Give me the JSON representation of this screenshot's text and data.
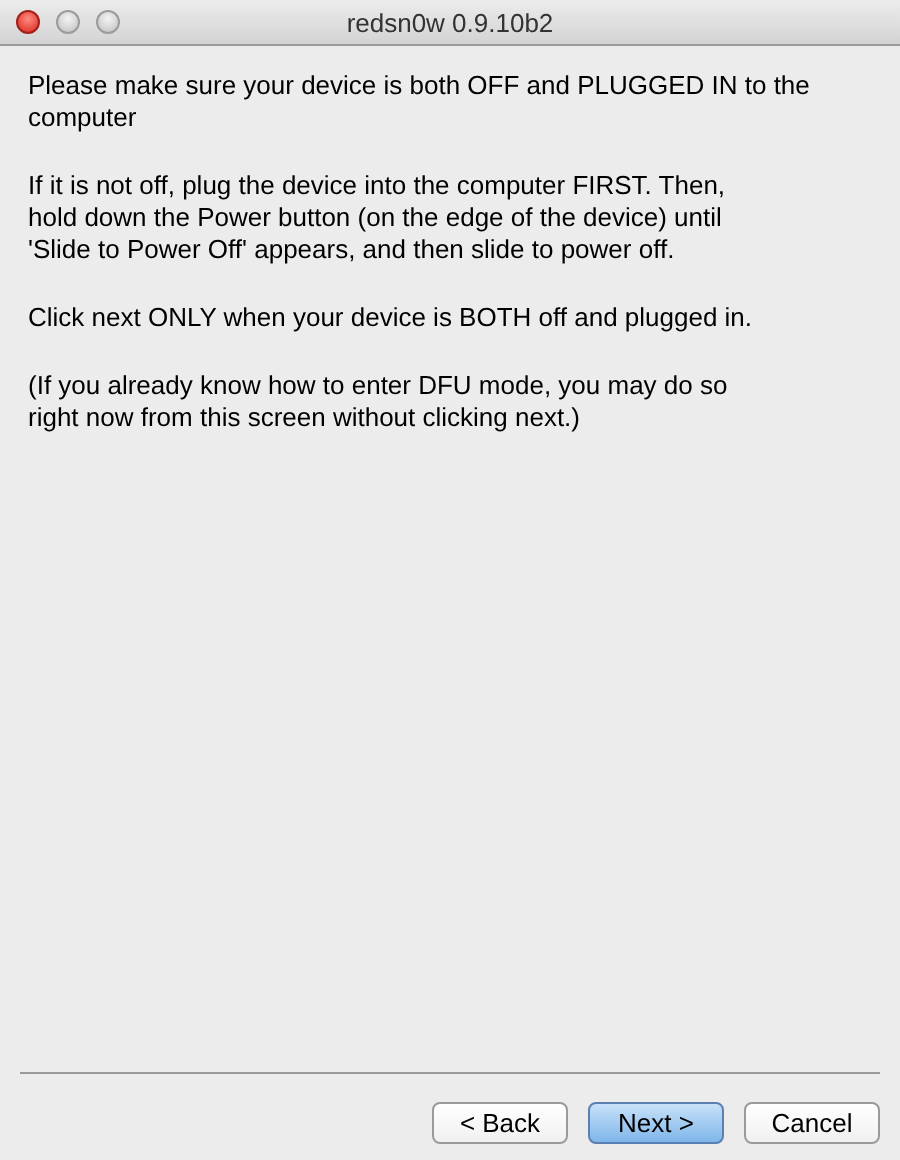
{
  "window": {
    "title": "redsn0w 0.9.10b2"
  },
  "paragraphs": [
    "Please make sure your device is both OFF and PLUGGED IN to the\ncomputer",
    "If it is not off, plug the device into the computer FIRST. Then,\nhold down the Power button (on the edge of the device) until\n'Slide to Power Off' appears, and then slide to power off.",
    "Click next ONLY when your device is BOTH off and plugged in.",
    "(If you already know how to enter DFU mode, you may do so\nright now from this screen without clicking next.)"
  ],
  "buttons": [
    {
      "label": "< Back",
      "default": false
    },
    {
      "label": "Next >",
      "default": true
    },
    {
      "label": "Cancel",
      "default": false
    }
  ]
}
